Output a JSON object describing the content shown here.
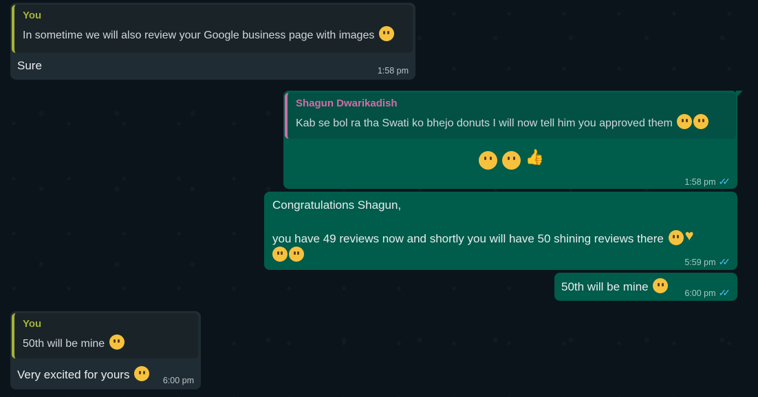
{
  "messages": [
    {
      "quote_author": "You",
      "quote_text": "In sometime we will also review your Google business page with images",
      "text": "Sure",
      "time": "1:58 pm"
    },
    {
      "quote_author": "Shagun Dwarikadish",
      "quote_text": "Kab se bol ra tha Swati ko bhejo donuts I will now tell him you approved them",
      "text": "",
      "time": "1:58 pm"
    },
    {
      "text_line1": "Congratulations Shagun,",
      "text_line2": "you have 49 reviews now and shortly you will have 50 shining reviews there",
      "time": "5:59 pm"
    },
    {
      "text": "50th will be mine",
      "time": "6:00 pm"
    },
    {
      "quote_author": "You",
      "quote_text": "50th will be mine",
      "text": "Very excited for yours",
      "time": "6:00 pm"
    }
  ],
  "colors": {
    "background": "#0b141a",
    "incoming_bubble": "#202c33",
    "outgoing_bubble": "#005c4b",
    "quote_you": "#a5b337",
    "quote_shagun": "#d36ca6",
    "read_ticks": "#53bdeb"
  },
  "icons": [
    "hugging-face-emoji",
    "grinning-emoji",
    "star-struck-emoji",
    "thumbs-up-emoji",
    "party-emoji",
    "heart-hands-emoji",
    "kiss-emoji",
    "double-check-icon"
  ]
}
